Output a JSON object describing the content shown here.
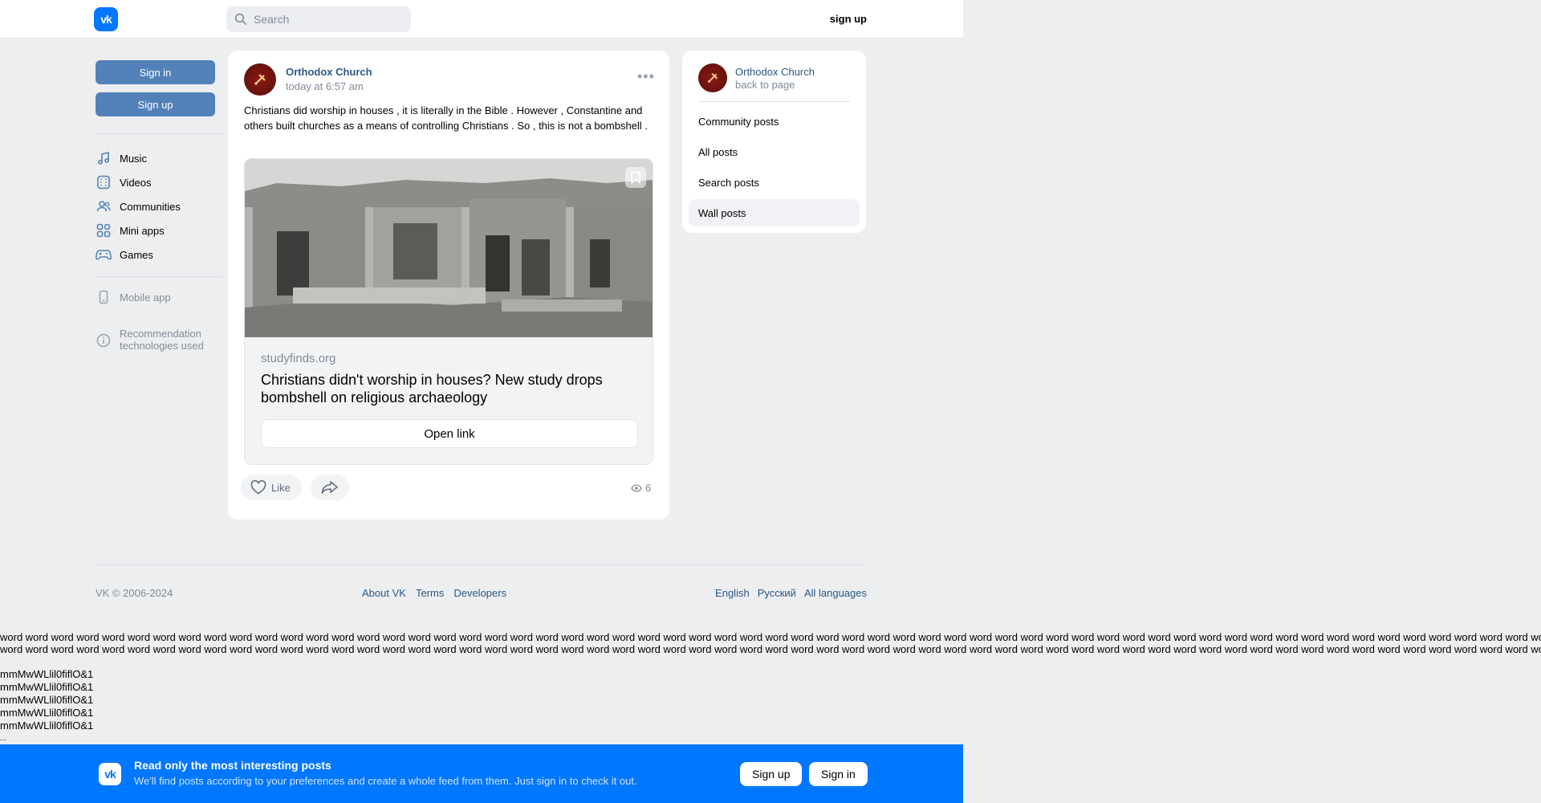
{
  "header": {
    "logo_text": "vk",
    "search_placeholder": "Search",
    "signup_label": "sign up"
  },
  "sidebar": {
    "sign_in": "Sign in",
    "sign_up": "Sign up",
    "items": [
      {
        "label": "Music",
        "icon": "music-icon"
      },
      {
        "label": "Videos",
        "icon": "video-icon"
      },
      {
        "label": "Communities",
        "icon": "users-icon"
      },
      {
        "label": "Mini apps",
        "icon": "apps-icon"
      },
      {
        "label": "Games",
        "icon": "gamepad-icon"
      }
    ],
    "mobile_app": "Mobile app",
    "recommendation_line1": "Recommendation",
    "recommendation_line2": "technologies used"
  },
  "post": {
    "author": "Orthodox Church",
    "time": "today at 6:57 am",
    "more": "•••",
    "text": "Christians did worship in houses , it is literally in the Bible . However , Constantine and others built churches as a means of controlling Christians . So , this is not a bombshell .",
    "link": {
      "domain": "studyfinds.org",
      "title": "Christians didn't worship in houses? New study drops bombshell on religious archaeology",
      "button": "Open link"
    },
    "like_label": "Like",
    "views": "6"
  },
  "panel": {
    "name": "Orthodox Church",
    "back": "back to page",
    "items": [
      "Community posts",
      "All posts",
      "Search posts",
      "Wall posts"
    ],
    "active_item": "Wall posts"
  },
  "footer": {
    "copyright": "VK © 2006-2024",
    "links": [
      "About VK",
      "Terms",
      "Developers"
    ],
    "languages": [
      "English",
      "Русский",
      "All languages"
    ]
  },
  "filler": {
    "word_line": "word word word word word word word word word word word word word word word word word word word word word word word word word word word word word word word word word word word word word word word word word word word word word word word word word word word word word word word word word word word word word word word word word word word word word word word word",
    "glyph_line": "mmMwWLlil0fiflO&1"
  },
  "banner": {
    "title": "Read only the most interesting posts",
    "subtitle": "We'll find posts according to your preferences and create a whole feed from them. Just sign in to check it out.",
    "sign_up": "Sign up",
    "sign_in": "Sign in"
  },
  "colors": {
    "brand": "#0077ff",
    "button_blue": "#5181b8",
    "link": "#2a5885",
    "background": "#edeef0"
  }
}
